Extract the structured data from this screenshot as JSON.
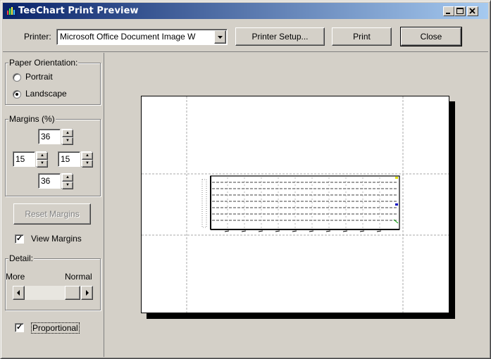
{
  "window": {
    "title": "TeeChart Print Preview"
  },
  "toolbar": {
    "printer_label": "Printer:",
    "printer_value": "Microsoft Office Document Image W",
    "setup_label": "Printer Setup...",
    "print_label": "Print",
    "close_label": "Close"
  },
  "orientation": {
    "title": "Paper Orientation:",
    "options": [
      {
        "label": "Portrait",
        "selected": false
      },
      {
        "label": "Landscape",
        "selected": true
      }
    ]
  },
  "margins": {
    "title": "Margins (%)",
    "top": "36",
    "left": "15",
    "right": "15",
    "bottom": "36",
    "reset_label": "Reset Margins",
    "view_label": "View Margins",
    "view_checked": true
  },
  "detail": {
    "title": "Detail:",
    "more_label": "More",
    "normal_label": "Normal"
  },
  "proportional": {
    "label": "Proportional",
    "checked": true
  },
  "colors": {
    "titlebar_start": "#0a246a",
    "titlebar_end": "#a6caf0",
    "face": "#d4d0c8"
  }
}
